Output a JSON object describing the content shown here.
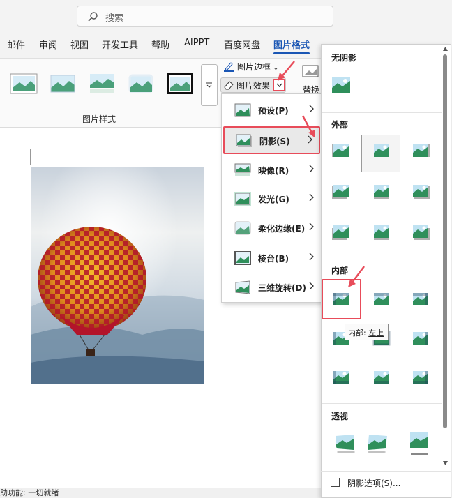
{
  "search": {
    "placeholder": "搜索"
  },
  "tabs": [
    {
      "label": "邮件"
    },
    {
      "label": "审阅"
    },
    {
      "label": "视图"
    },
    {
      "label": "开发工具"
    },
    {
      "label": "帮助"
    },
    {
      "label": "AIPPT"
    },
    {
      "label": "百度网盘"
    },
    {
      "label": "图片格式"
    }
  ],
  "ribbon": {
    "group_label": "图片样式",
    "border_label": "图片边框",
    "effects_label": "图片效果",
    "replace_label": "替换"
  },
  "effects_menu": {
    "items": [
      {
        "label": "预设",
        "key": "(P)"
      },
      {
        "label": "阴影",
        "key": "(S)"
      },
      {
        "label": "映像",
        "key": "(R)"
      },
      {
        "label": "发光",
        "key": "(G)"
      },
      {
        "label": "柔化边缘",
        "key": "(E)"
      },
      {
        "label": "棱台",
        "key": "(B)"
      },
      {
        "label": "三维旋转",
        "key": "(D)"
      }
    ]
  },
  "shadow_panel": {
    "none_header": "无阴影",
    "outer_header": "外部",
    "inner_header": "内部",
    "perspective_header": "透视",
    "options_label": "阴影选项(S)...",
    "tooltip_prefix": "内部: ",
    "tooltip_value": "左上"
  },
  "status": {
    "text": "助功能: 一切就绪"
  },
  "colors": {
    "accent": "#1a56b4",
    "highlight_red": "#e84c5a"
  }
}
